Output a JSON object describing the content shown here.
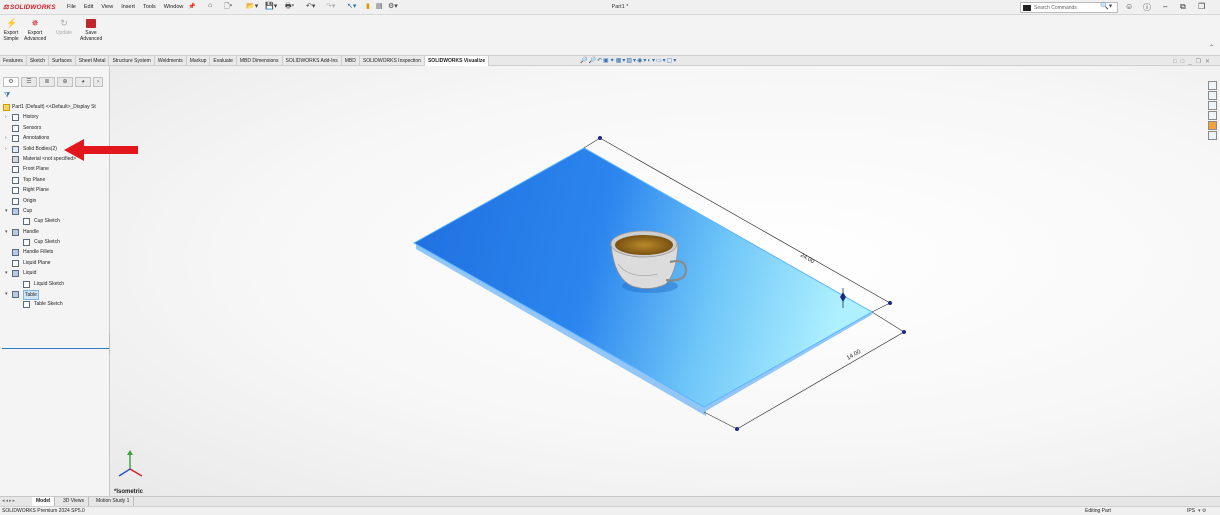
{
  "app": {
    "brand": "SOLIDWORKS",
    "menus": [
      "File",
      "Edit",
      "View",
      "Insert",
      "Tools",
      "Window"
    ],
    "document_title": "Part1 *",
    "search_placeholder": "Search Commands"
  },
  "ribbon": {
    "buttons": [
      {
        "line1": "Export",
        "line2": "Simple",
        "icon": "lightning-icon",
        "enabled": true
      },
      {
        "line1": "Export",
        "line2": "Advanced",
        "icon": "fan-export-icon",
        "enabled": true
      },
      {
        "line1": "Update",
        "line2": "",
        "icon": "update-icon",
        "enabled": false
      },
      {
        "line1": "Save",
        "line2": "Advanced",
        "icon": "save-icon",
        "enabled": true
      }
    ]
  },
  "command_tabs": [
    "Features",
    "Sketch",
    "Surfaces",
    "Sheet Metal",
    "Structure System",
    "Weldments",
    "Markup",
    "Evaluate",
    "MBD Dimensions",
    "SOLIDWORKS Add-Ins",
    "MBD",
    "SOLIDWORKS Inspection",
    "SOLIDWORKS Visualize"
  ],
  "active_command_tab": "SOLIDWORKS Visualize",
  "feature_tree": {
    "root": "Part1 (Default) <<Default>_Display St",
    "items": [
      {
        "label": "History",
        "indent": 0,
        "expandable": true,
        "icon": "history-icon"
      },
      {
        "label": "Sensors",
        "indent": 0,
        "expandable": false,
        "icon": "sensors-icon"
      },
      {
        "label": "Annotations",
        "indent": 0,
        "expandable": true,
        "icon": "annotations-icon"
      },
      {
        "label": "Solid Bodies(2)",
        "indent": 0,
        "expandable": true,
        "icon": "solid-bodies-icon"
      },
      {
        "label": "Material <not specified>",
        "indent": 0,
        "expandable": false,
        "icon": "material-icon"
      },
      {
        "label": "Front Plane",
        "indent": 0,
        "expandable": false,
        "icon": "plane-icon"
      },
      {
        "label": "Top Plane",
        "indent": 0,
        "expandable": false,
        "icon": "plane-icon"
      },
      {
        "label": "Right Plane",
        "indent": 0,
        "expandable": false,
        "icon": "plane-icon"
      },
      {
        "label": "Origin",
        "indent": 0,
        "expandable": false,
        "icon": "origin-icon"
      },
      {
        "label": "Cup",
        "indent": 0,
        "expandable": true,
        "icon": "revolve-icon"
      },
      {
        "label": "Cup Sketch",
        "indent": 1,
        "expandable": false,
        "icon": "sketch-icon"
      },
      {
        "label": "Handle",
        "indent": 0,
        "expandable": true,
        "icon": "sweep-icon"
      },
      {
        "label": "Cup Sketch",
        "indent": 1,
        "expandable": false,
        "icon": "sketch-icon"
      },
      {
        "label": "Handle Fillets",
        "indent": 0,
        "expandable": false,
        "icon": "fillet-icon"
      },
      {
        "label": "Liquid Plane",
        "indent": 0,
        "expandable": false,
        "icon": "plane-icon"
      },
      {
        "label": "Liquid",
        "indent": 0,
        "expandable": true,
        "icon": "extrude-icon"
      },
      {
        "label": "Liquid Sketch",
        "indent": 1,
        "expandable": false,
        "icon": "sketch-icon"
      },
      {
        "label": "Table",
        "indent": 0,
        "expandable": true,
        "icon": "extrude-icon",
        "selected": true
      },
      {
        "label": "Table Sketch",
        "indent": 1,
        "expandable": false,
        "icon": "sketch-icon"
      }
    ]
  },
  "viewport": {
    "view_name": "*Isometric",
    "dimensions": [
      "24.00",
      "14.00"
    ],
    "plate_color": "#2f8ff0",
    "plate_highlight": "#9fe8ff"
  },
  "bottom_tabs": [
    "Model",
    "3D Views",
    "Motion Study 1"
  ],
  "active_bottom_tab": "Model",
  "status": {
    "product": "SOLIDWORKS Premium 2024 SP5.0",
    "mode": "Editing Part",
    "units": "IPS"
  },
  "colors": {
    "annotation_arrow": "#e3161b",
    "brand_red": "#d5202c"
  }
}
